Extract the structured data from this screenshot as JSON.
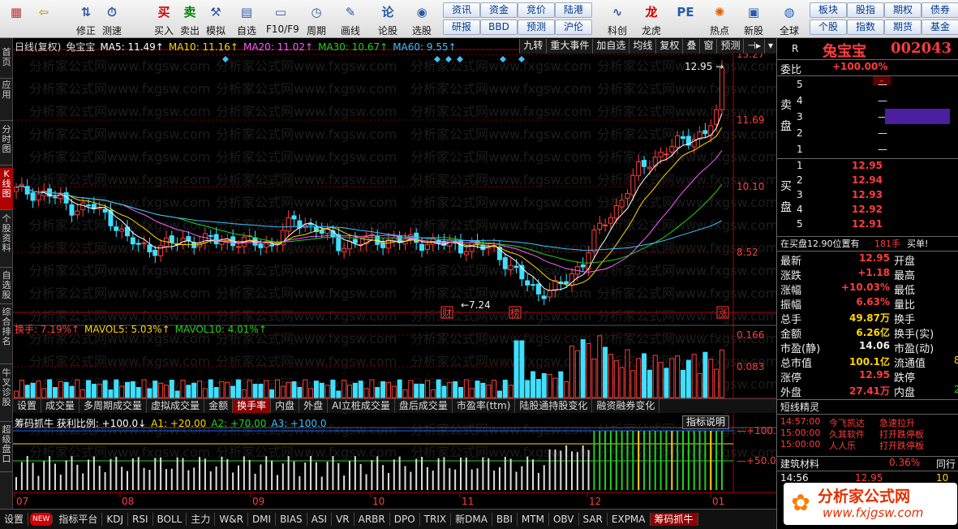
{
  "toolbar": {
    "left": [
      {
        "label": "",
        "icon": "home-icon"
      },
      {
        "label": "",
        "icon": "back-icon"
      },
      {
        "label": "修正",
        "icon": "modify-icon"
      },
      {
        "label": "测速",
        "icon": "speed-icon"
      },
      {
        "label": "买入",
        "icon": "buy-icon",
        "glyph": "买"
      },
      {
        "label": "卖出",
        "icon": "sell-icon",
        "glyph": "卖"
      },
      {
        "label": "模拟",
        "icon": "simulate-icon"
      },
      {
        "label": "自选",
        "icon": "watchlist-icon"
      },
      {
        "label": "F10/F9",
        "icon": "f10-icon"
      },
      {
        "label": "周期",
        "icon": "period-icon"
      },
      {
        "label": "画线",
        "icon": "draw-icon"
      },
      {
        "label": "论股",
        "icon": "discuss-icon",
        "glyph": "论"
      },
      {
        "label": "选股",
        "icon": "select-stock-icon"
      }
    ],
    "mid_buttons": [
      [
        "资讯",
        "资金",
        "竞价",
        "陆港"
      ],
      [
        "研报",
        "BBD",
        "预测",
        "沪伦"
      ]
    ],
    "right": [
      {
        "label": "科创",
        "icon": "kechuang-icon"
      },
      {
        "label": "龙虎",
        "icon": "longhu-icon"
      },
      {
        "label": "",
        "icon": "pe-icon",
        "glyph": "PE"
      },
      {
        "label": "热点",
        "icon": "hot-icon"
      },
      {
        "label": "新股",
        "icon": "ipo-icon"
      },
      {
        "label": "全球",
        "icon": "globe-icon"
      }
    ],
    "right_buttons": [
      [
        "板块",
        "股指",
        "期权",
        "债券"
      ],
      [
        "个股",
        "指数",
        "期货",
        "基金"
      ]
    ]
  },
  "left_nav": [
    "首页",
    "应用",
    "分时图",
    "K线图",
    "个股资料",
    "自选股",
    "综合排名",
    "牛叉诊股",
    "超级盘口"
  ],
  "chart": {
    "title": "日线(复权)",
    "stock_name": "兔宝宝",
    "ma_labels": [
      {
        "text": "MA5: 11.49↑",
        "color": "#ffffff"
      },
      {
        "text": "MA10: 11.16↑",
        "color": "#ffd700"
      },
      {
        "text": "MA20: 11.02↑",
        "color": "#ff5cff"
      },
      {
        "text": "MA30: 10.67↑",
        "color": "#1fd21f"
      },
      {
        "text": "MA60: 9.55↑",
        "color": "#3fbfff"
      }
    ],
    "top_buttons": [
      "九转",
      "重大事件",
      "加自选",
      "均线",
      "复权",
      "叠",
      "窗",
      "预测",
      "⊣▸",
      "▾"
    ],
    "price_axis": [
      "13.27",
      "11.69",
      "10.10",
      "8.52"
    ],
    "high_label": "12.95",
    "low_label": "7.24",
    "markers": [
      "财",
      "榜",
      "涨"
    ],
    "volume_labels": [
      {
        "text": "换手: 7.19%↑",
        "color": "#ff4040"
      },
      {
        "text": "MAVOL5: 5.03%↑",
        "color": "#ffd700"
      },
      {
        "text": "MAVOL10: 4.01%↑",
        "color": "#1fd21f"
      }
    ],
    "volume_axis": [
      "0.166",
      "0.083"
    ],
    "tabs1": [
      "设置",
      "成交量",
      "多周期成交量",
      "虚拟成交量",
      "金额",
      "换手率",
      "内盘",
      "外盘",
      "AI立桩成交量",
      "盘后成交量",
      "市盈率(ttm)",
      "陆股通持股变化",
      "融资融券变化"
    ],
    "tabs1_active": "换手率",
    "indicator_labels": [
      {
        "text": "筹码抓牛 获利比例: +100.0↓",
        "color": "#ffffff"
      },
      {
        "text": "A1: +20.00",
        "color": "#ffd700"
      },
      {
        "text": "A2: +70.00",
        "color": "#1fd21f"
      },
      {
        "text": "A3: +100.0",
        "color": "#3fbfff"
      }
    ],
    "indicator_button": "指标说明",
    "indicator_axis": [
      "+100.0",
      "+50.00"
    ],
    "x_labels": [
      "07",
      "08",
      "09",
      "10",
      "11",
      "12",
      "01"
    ],
    "watermark": "分析家公式网www.fxgsw.com"
  },
  "bottom_tabs": [
    "设置",
    "NEW",
    "指标平台",
    "KDJ",
    "RSI",
    "BOLL",
    "主力",
    "W&R",
    "DMI",
    "BIAS",
    "ASI",
    "VR",
    "ARBR",
    "DPO",
    "TRIX",
    "新DMA",
    "BBI",
    "MTM",
    "OBV",
    "SAR",
    "EXPMA",
    "筹码抓牛"
  ],
  "bottom_active": "筹码抓牛",
  "quote": {
    "r_label": "R",
    "name": "兔宝宝",
    "code": "002043",
    "weibi_label": "委比",
    "weibi": "+100.00%",
    "sell_label": "卖盘",
    "buy_label": "买盘",
    "sell": [
      {
        "n": "5",
        "p": ""
      },
      {
        "n": "4",
        "p": ""
      },
      {
        "n": "3",
        "p": ""
      },
      {
        "n": "2",
        "p": ""
      },
      {
        "n": "1",
        "p": ""
      }
    ],
    "buy": [
      {
        "n": "1",
        "p": "12.95"
      },
      {
        "n": "2",
        "p": "12.94"
      },
      {
        "n": "3",
        "p": "12.93"
      },
      {
        "n": "4",
        "p": "12.92"
      },
      {
        "n": "5",
        "p": "12.91"
      }
    ],
    "buy_queue": "在买盘12.90位置有",
    "buy_queue_vol": "181手",
    "buy_queue_action": "买单!",
    "stats": [
      [
        "最新",
        "12.95",
        "开盘",
        ""
      ],
      [
        "涨跌",
        "+1.18",
        "最高",
        ""
      ],
      [
        "涨幅",
        "+10.03%",
        "最低",
        ""
      ],
      [
        "振幅",
        "6.63%",
        "量比",
        ""
      ],
      [
        "总手",
        "49.87万",
        "换手",
        ""
      ],
      [
        "金额",
        "6.26亿",
        "换手(实)",
        ""
      ],
      [
        "市盈(静)",
        "14.06",
        "市盈(动)",
        ""
      ],
      [
        "总市值",
        "100.1亿",
        "流通值",
        "8"
      ],
      [
        "涨停",
        "12.95",
        "跌停",
        ""
      ],
      [
        "外盘",
        "27.41万",
        "内盘",
        "2"
      ]
    ],
    "elf_title": "短线精灵",
    "elf": [
      {
        "time": "14:57:00",
        "name": "今飞凯达",
        "event": "急速拉升"
      },
      {
        "time": "15:00:00",
        "name": "久其软件",
        "event": "打开跌停板"
      },
      {
        "time": "15:00:00",
        "name": "人人乐",
        "event": "打开跌停板"
      }
    ],
    "sector": "建筑材料",
    "sector_pct": "0.36%",
    "sector_right": "同行",
    "tick_time": "14:56",
    "tick_price": "12.95",
    "tick_vol": "10"
  },
  "logo_text": "分析家公式网",
  "logo_url": "www.fxjgsw.com",
  "colors": {
    "up": "#ff3c3c",
    "down": "#16d216",
    "flat": "#3fe0ff",
    "accent": "#b00000"
  }
}
